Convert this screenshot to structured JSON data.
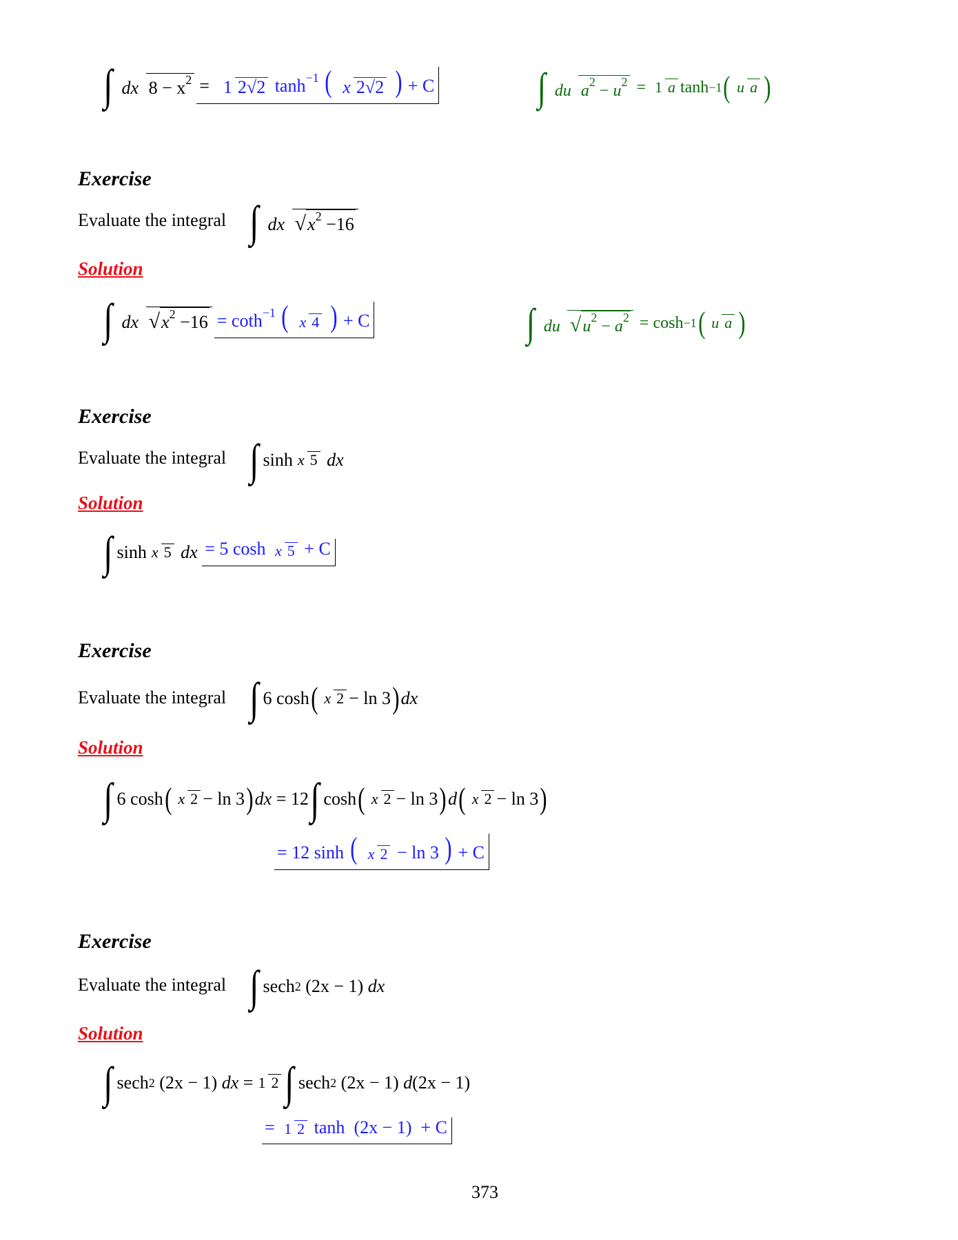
{
  "formulas": {
    "tanh_formula": {
      "du": "du",
      "a2u2": "a",
      "sq": "2",
      "u2": "u",
      "one": "1",
      "a": "a",
      "tanh_inv": "tanh",
      "inv": "−1",
      "u": "u"
    },
    "cosh_formula": {
      "du": "du",
      "u2a2": "u",
      "sq": "2",
      "a": "a",
      "cosh_inv": "cosh",
      "inv": "−1",
      "u": "u"
    }
  },
  "top_result": {
    "dx": "dx",
    "den": "8 − x",
    "sq": "2",
    "one": "1",
    "twoRootTwo": "2√2",
    "tanh": "tanh",
    "inv": "−1",
    "x": "x",
    "plusC": "+ C"
  },
  "exercises": [
    {
      "heading": "Exercise",
      "prompt": "Evaluate the integral",
      "integrand": {
        "dx": "dx",
        "under": "x",
        "sq": "2",
        "rest": "−16"
      },
      "solution_label": "Solution",
      "answer": {
        "eq": "= coth",
        "inv": "−1",
        "x": "x",
        "four": "4",
        "plusC": "+ C"
      }
    },
    {
      "heading": "Exercise",
      "prompt": "Evaluate the integral",
      "integrand": {
        "sinh": "sinh",
        "x": "x",
        "five": "5",
        "dx": "dx"
      },
      "solution_label": "Solution",
      "answer": {
        "eq": "= 5 cosh",
        "x": "x",
        "five": "5",
        "plusC": "+ C"
      }
    },
    {
      "heading": "Exercise",
      "prompt": "Evaluate the integral",
      "integrand": {
        "six_cosh": "6 cosh",
        "x": "x",
        "two": "2",
        "minus_ln3": "− ln 3",
        "dx": "dx"
      },
      "solution_label": "Solution",
      "step": {
        "eq12": "= 12",
        "cosh": "cosh",
        "d": "d"
      },
      "answer": {
        "eq": "= 12 sinh",
        "x": "x",
        "two": "2",
        "minus_ln3": "− ln 3",
        "plusC": "+ C"
      }
    },
    {
      "heading": "Exercise",
      "prompt": "Evaluate the integral",
      "integrand": {
        "sech": "sech",
        "sq": "2",
        "arg": "(2x − 1)",
        "dx": "dx"
      },
      "solution_label": "Solution",
      "step": {
        "eq": "=",
        "one": "1",
        "two": "2",
        "d": "d",
        "darg": "(2x − 1)"
      },
      "answer": {
        "eq": "=",
        "one": "1",
        "two": "2",
        "tanh": "tanh",
        "arg": "(2x − 1)",
        "plusC": "+ C"
      }
    }
  ],
  "page_number": "373"
}
